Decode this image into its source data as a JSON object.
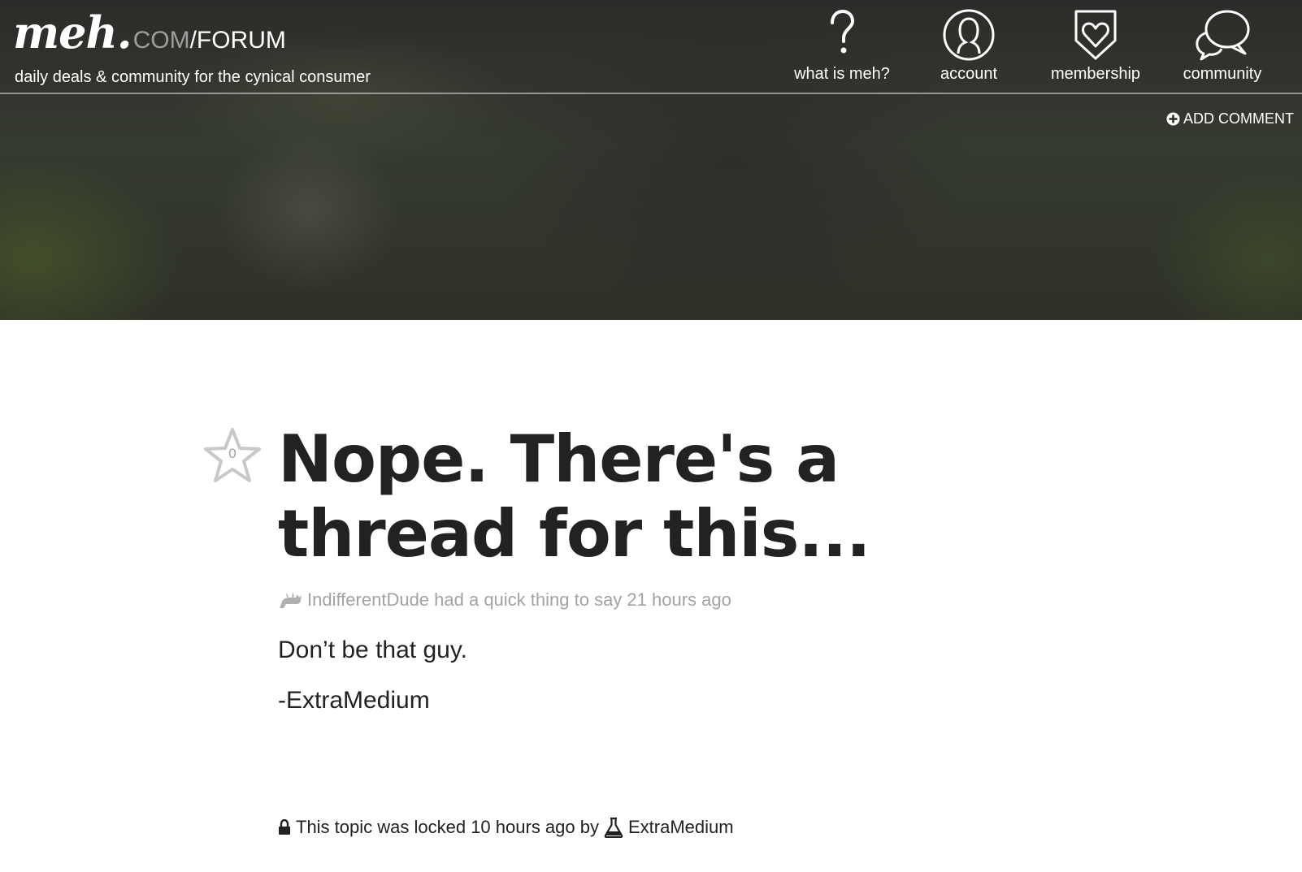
{
  "header": {
    "logo": {
      "meh": "meh.",
      "com": "COM",
      "forum": "/FORUM"
    },
    "tagline": "daily deals & community for the cynical consumer",
    "nav": [
      {
        "label": "what is meh?",
        "icon": "question-icon"
      },
      {
        "label": "account",
        "icon": "account-icon"
      },
      {
        "label": "membership",
        "icon": "membership-heart-shield-icon"
      },
      {
        "label": "community",
        "icon": "speech-bubble-icon"
      }
    ],
    "add_comment": "ADD COMMENT"
  },
  "post": {
    "star_count": "0",
    "title": "Nope. There's a thread for this...",
    "byline": "IndifferentDude had a quick thing to say 21 hours ago",
    "body": [
      "Don’t be that guy.",
      "-ExtraMedium"
    ]
  },
  "lock_notice": {
    "text": "This topic was locked 10 hours ago by",
    "user": "ExtraMedium"
  },
  "colors": {
    "title": "#222222",
    "meta": "#a3a3a3",
    "header_text": "#ffffff",
    "logo_com": "#9d9d9d"
  }
}
